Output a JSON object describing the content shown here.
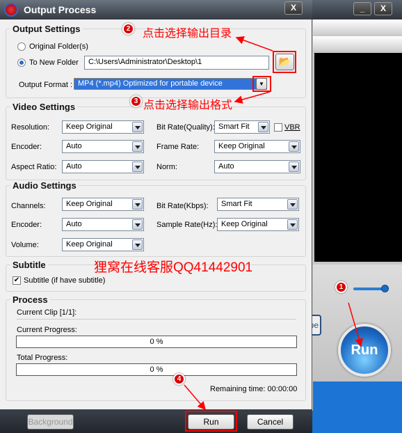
{
  "window_title": "Output Process",
  "close_label": "X",
  "bg_app": {
    "minimize_label": "_",
    "close_label": "X",
    "run_label": "Run",
    "type_button_partial": "pe"
  },
  "output_settings": {
    "title": "Output Settings",
    "original_folder": "Original Folder(s)",
    "new_folder": "To New Folder",
    "folder_path": "C:\\Users\\Administrator\\Desktop\\1",
    "format_label": "Output Format :",
    "format_value": "MP4  (*.mp4) Optimized for portable device",
    "selected_option": "To New Folder"
  },
  "video_settings": {
    "title": "Video Settings",
    "resolution_label": "Resolution:",
    "resolution": "Keep Original",
    "encoder_label": "Encoder:",
    "encoder": "Auto",
    "aspect_label": "Aspect Ratio:",
    "aspect": "Auto",
    "bitrate_label": "Bit Rate(Quality):",
    "bitrate": "Smart Fit",
    "vbr_label": "VBR",
    "vbr_checked": false,
    "framerate_label": "Frame Rate:",
    "framerate": "Keep Original",
    "norm_label": "Norm:",
    "norm": "Auto"
  },
  "audio_settings": {
    "title": "Audio Settings",
    "channels_label": "Channels:",
    "channels": "Keep Original",
    "encoder_label": "Encoder:",
    "encoder": "Auto",
    "volume_label": "Volume:",
    "volume": "Keep Original",
    "bitrate_label": "Bit Rate(Kbps):",
    "bitrate": "Smart Fit",
    "samplerate_label": "Sample Rate(Hz):",
    "samplerate": "Keep Original"
  },
  "subtitle": {
    "title": "Subtitle",
    "checkbox_label": "Subtitle (if have subtitle)",
    "checked": true
  },
  "process": {
    "title": "Process",
    "current_clip": "Current Clip [1/1]:",
    "current_progress_label": "Current Progress:",
    "current_progress": "0 %",
    "total_progress_label": "Total Progress:",
    "total_progress": "0 %",
    "remaining": "Remaining time: 00:00:00"
  },
  "buttons": {
    "background": "Background",
    "run": "Run",
    "cancel": "Cancel"
  },
  "annotations": {
    "a1": "1",
    "a2": "2",
    "a2_text": "点击选择输出目录",
    "a3": "3",
    "a3_text": "点击选择输出格式",
    "a4": "4",
    "watermark": "狸窝在线客服QQ41442901",
    "color": "#ff0000"
  }
}
